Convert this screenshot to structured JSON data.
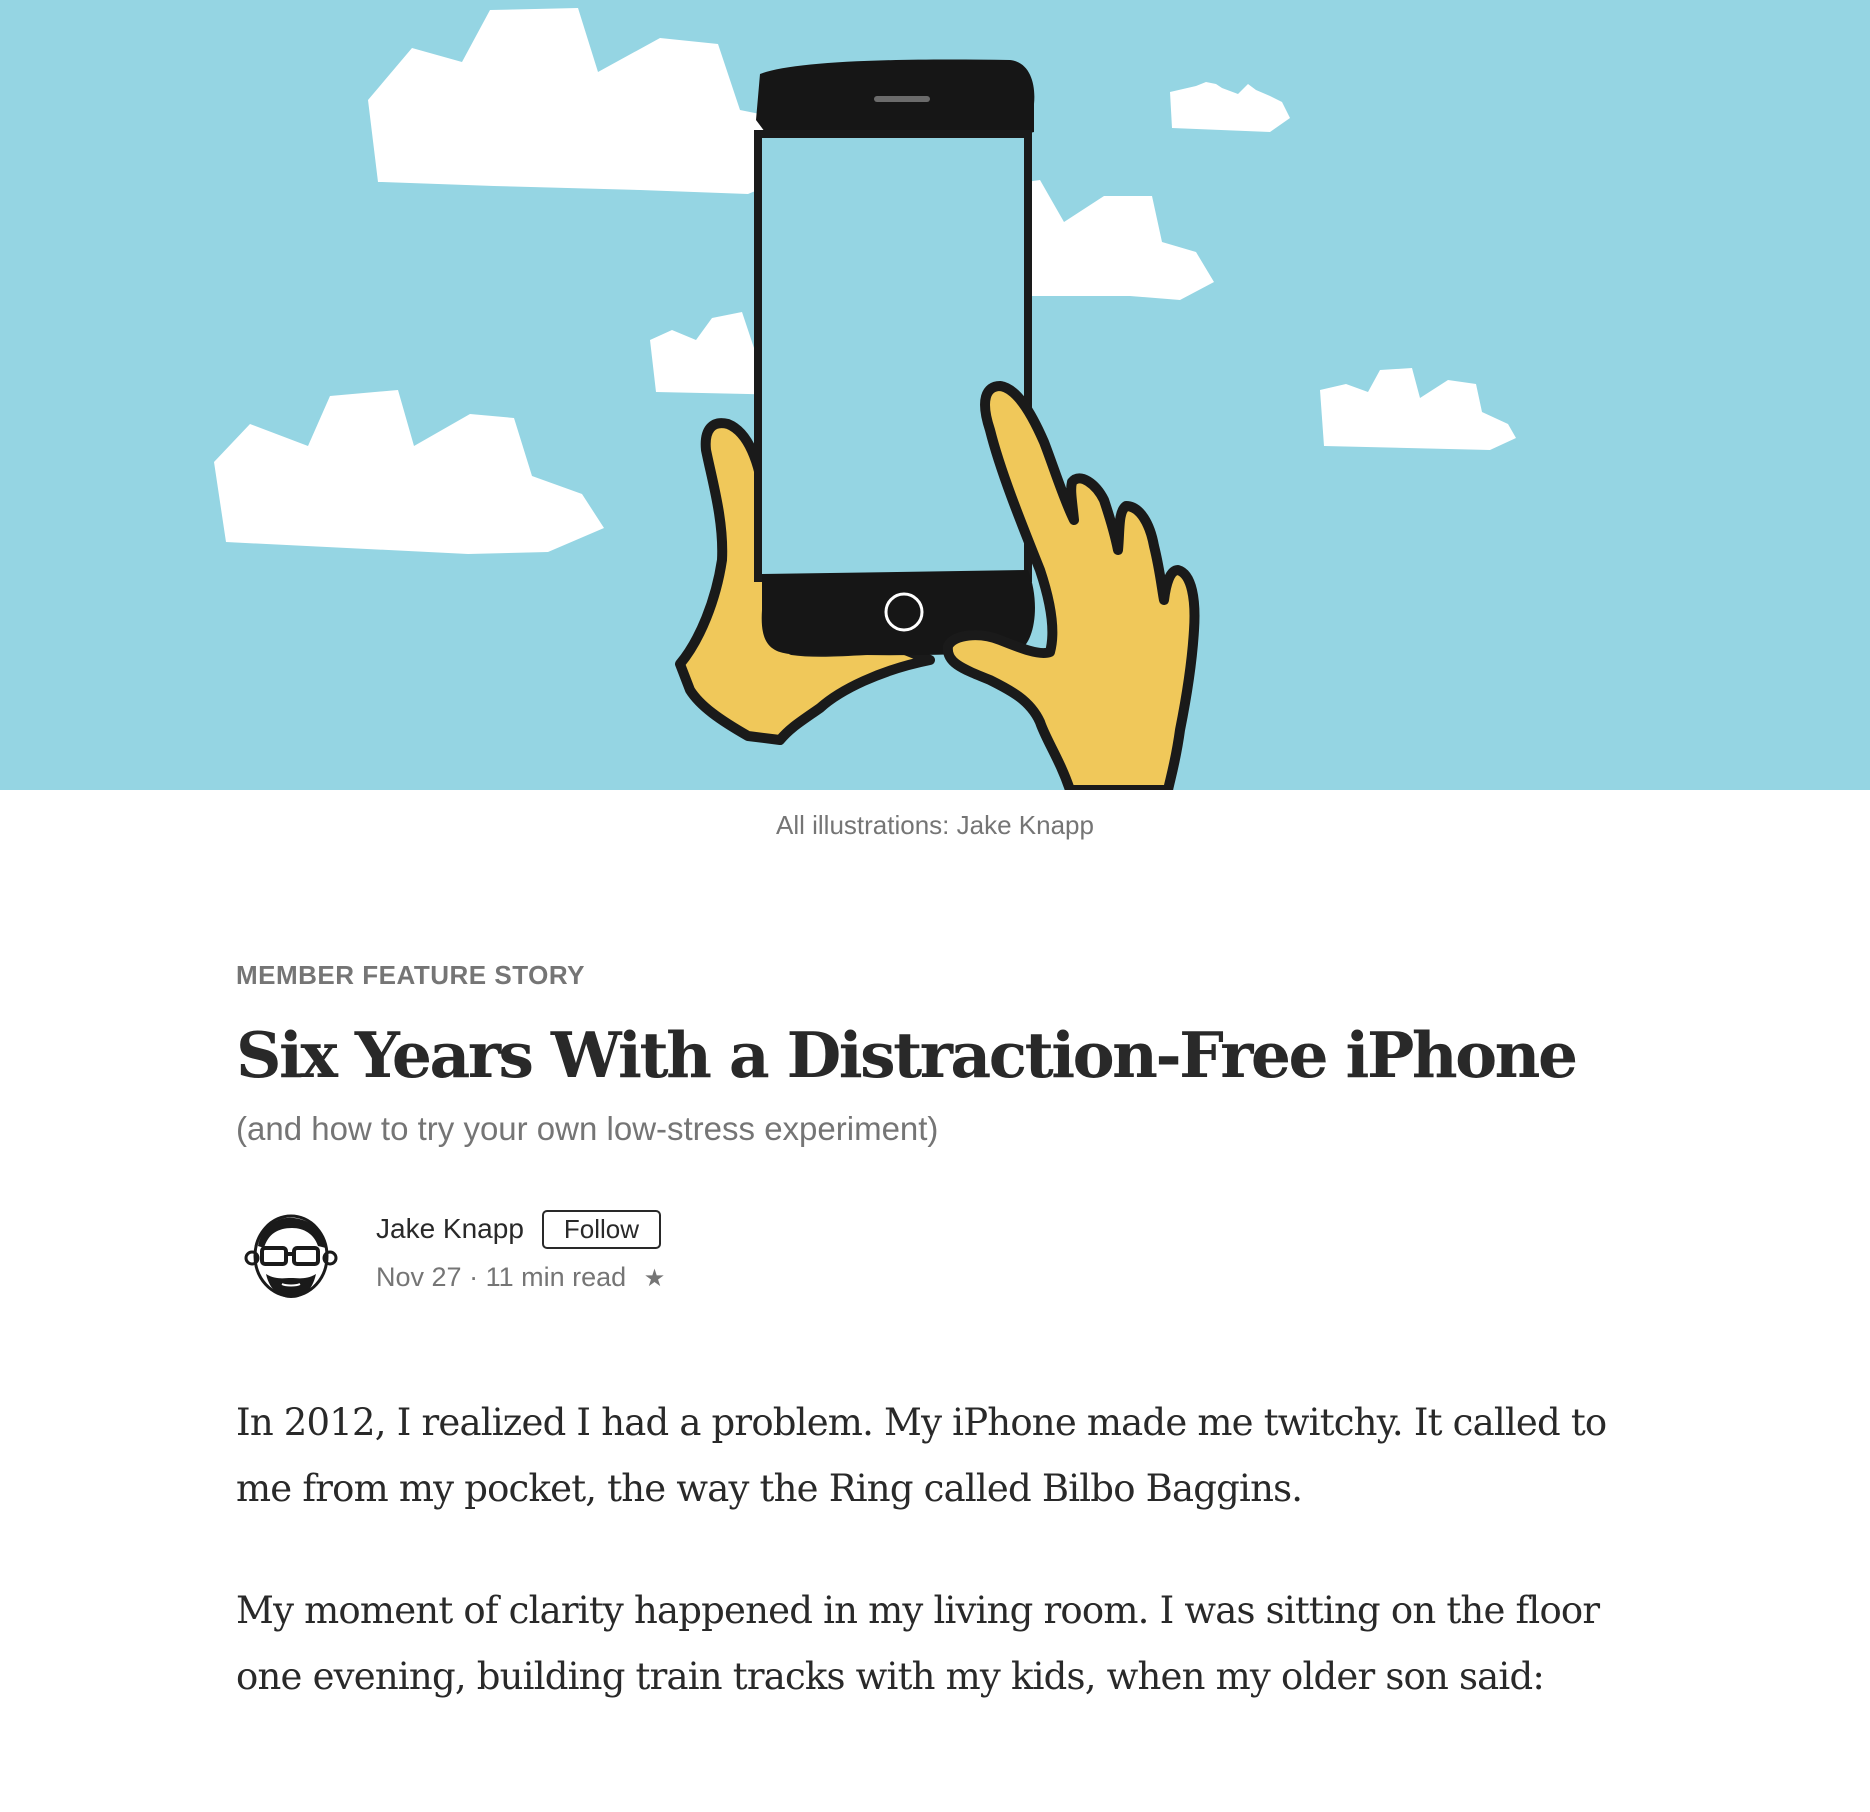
{
  "hero": {
    "caption": "All illustrations: Jake Knapp",
    "colors": {
      "sky": "#95d5e3",
      "cloud": "#ffffff",
      "hand": "#f0c85a",
      "phone": "#161616"
    }
  },
  "article": {
    "kicker": "MEMBER FEATURE STORY",
    "title": "Six Years With a Distraction-Free iPhone",
    "subtitle": "(and how to try your own low-stress experiment)",
    "author": {
      "name": "Jake Knapp",
      "follow_label": "Follow",
      "date": "Nov 27",
      "separator": "·",
      "read_time": "11 min read",
      "star": "★"
    },
    "paragraphs": [
      "In 2012, I realized I had a problem. My iPhone made me twitchy. It called to me from my pocket, the way the Ring called Bilbo Baggins.",
      "My moment of clarity happened in my living room. I was sitting on the floor one evening, building train tracks with my kids, when my older son said:"
    ]
  }
}
